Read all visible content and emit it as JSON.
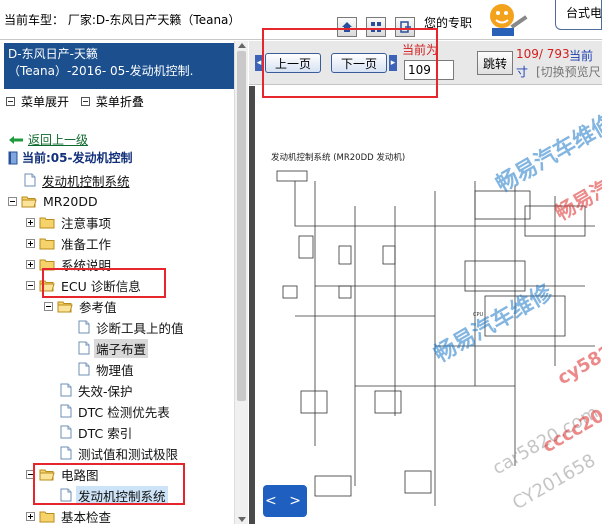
{
  "topbar": {
    "car_model": "当前车型：  厂家:D-东风日产天籁（Teana）",
    "car_model_year": "2016",
    "your_profile": "您的专职",
    "desk_label": "台式电"
  },
  "sidebar": {
    "header_line1": "D-东风日产-天籁",
    "header_line2": "（Teana）-2016- 05-发动机控制.",
    "expand_label": "菜单展开",
    "collapse_label": "菜单折叠",
    "back_label": "返回上一级",
    "current_label": "当前:05-发动机控制",
    "tree": [
      {
        "label": "发动机控制系统"
      },
      {
        "label": "MR20DD"
      },
      {
        "label": "注意事项"
      },
      {
        "label": "准备工作"
      },
      {
        "label": "系统说明"
      },
      {
        "label": "ECU 诊断信息"
      },
      {
        "label": "参考值"
      },
      {
        "label": "诊断工具上的值"
      },
      {
        "label": "端子布置"
      },
      {
        "label": "物理值"
      },
      {
        "label": "失效-保护"
      },
      {
        "label": "DTC 检测优先表"
      },
      {
        "label": "DTC 索引"
      },
      {
        "label": "测试值和测试极限"
      },
      {
        "label": "电路图"
      },
      {
        "label": "发动机控制系统"
      },
      {
        "label": "基本检查"
      }
    ]
  },
  "navbar": {
    "prev_label": "上一页",
    "next_label": "下一页",
    "current_page_label": "当前为",
    "page_value": "109",
    "jump_label": "跳转",
    "total_pages": "109/ 793",
    "current_blue": "当前",
    "unit_char": "寸",
    "switch_preview": "[切换预览尺"
  },
  "diagram": {
    "title": "发动机控制系统 (MR20DD 发动机)",
    "cpu_label": "CPU",
    "watermark_cn": "畅易汽车维修",
    "watermark_cn_repeat": "畅易汽车维修",
    "watermark_num": "cy5820",
    "watermark_url1": "car5820.com",
    "watermark_url2": "CY201658",
    "watermark_red1": "畅易汽车维",
    "watermark_red2": "cccc20",
    "prevnext_label": "< >"
  }
}
